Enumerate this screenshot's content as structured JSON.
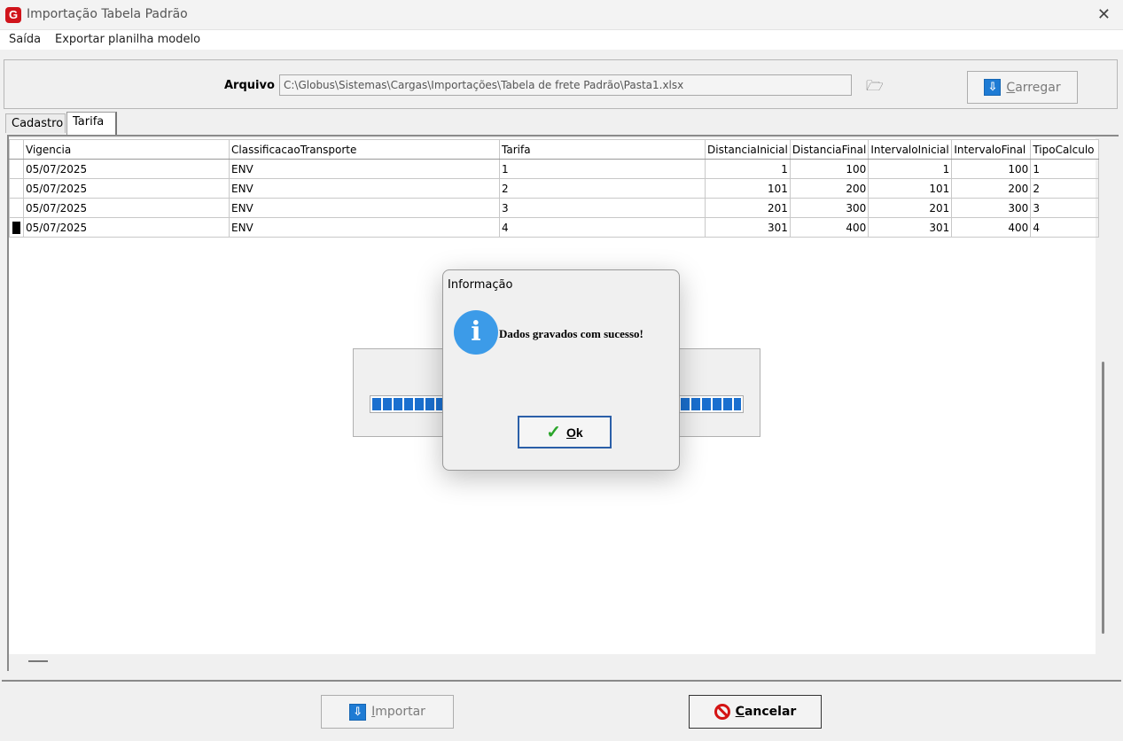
{
  "window": {
    "title": "Importação Tabela Padrão",
    "close": "✕",
    "app_icon": "G"
  },
  "menu": {
    "items": [
      "Saída",
      "Exportar planilha modelo"
    ]
  },
  "arquivo": {
    "label": "Arquivo",
    "value": "C:\\Globus\\Sistemas\\Cargas\\Importações\\Tabela de frete Padrão\\Pasta1.xlsx",
    "folder_icon": "🗁"
  },
  "carregar": {
    "label_u": "C",
    "label_rest": "arregar"
  },
  "tabs": [
    "Cadastro",
    "Tarifa"
  ],
  "grid": {
    "columns": [
      "Vigencia",
      "ClassificacaoTransporte",
      "Tarifa",
      "DistanciaInicial",
      "DistanciaFinal",
      "IntervaloInicial",
      "IntervaloFinal",
      "TipoCalculo"
    ],
    "rows": [
      [
        "05/07/2025",
        "ENV",
        "1",
        "1",
        "100",
        "1",
        "100",
        "1"
      ],
      [
        "05/07/2025",
        "ENV",
        "2",
        "101",
        "200",
        "101",
        "200",
        "2"
      ],
      [
        "05/07/2025",
        "ENV",
        "3",
        "201",
        "300",
        "201",
        "300",
        "3"
      ],
      [
        "05/07/2025",
        "ENV",
        "4",
        "301",
        "400",
        "301",
        "400",
        "4"
      ]
    ],
    "current_row": 3
  },
  "progress": {
    "fraction": 1.0
  },
  "dialog": {
    "title": "Informação",
    "icon": "i",
    "message": "Dados gravados com sucesso!",
    "ok_u": "O",
    "ok_rest": "k",
    "check": "✓"
  },
  "importar": {
    "label_u": "I",
    "label_rest": "mportar"
  },
  "cancelar": {
    "label_u": "C",
    "label_rest": "ancelar"
  },
  "colors": {
    "accent": "#1e7bd4",
    "danger": "#d41414",
    "info": "#3c9be8",
    "ok": "#2aa52a"
  }
}
